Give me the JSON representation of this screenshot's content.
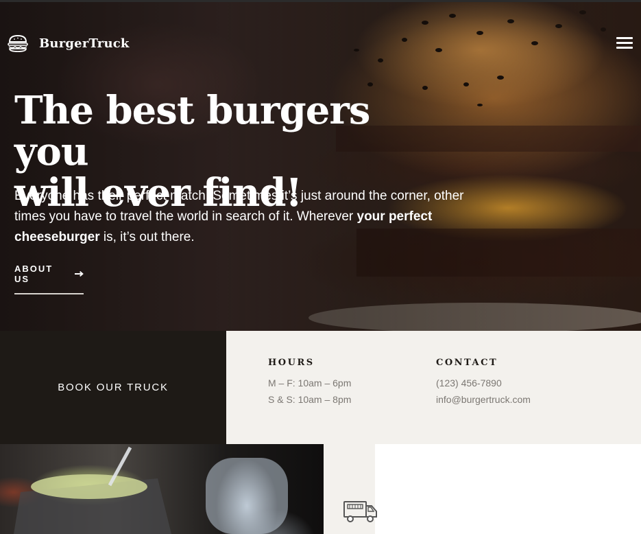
{
  "header": {
    "brand_name": "BurgerTruck",
    "logo_icon": "burger-icon",
    "menu_icon": "hamburger-menu-icon"
  },
  "hero": {
    "title_line1": "The best burgers you",
    "title_line2": "will ever find!",
    "text_part1": "Everyone has their perfect match. Sometimes it’s just around the corner, other times you have to travel the world in search of it. Wherever ",
    "text_bold1": "your perfect",
    "text_space": " ",
    "text_bold2": "cheeseburger",
    "text_part2": " is, it’s out there.",
    "cta_label": "ABOUT US",
    "cta_icon": "arrow-right-icon"
  },
  "booking": {
    "button_label": "BOOK OUR TRUCK"
  },
  "info": {
    "hours_heading": "HOURS",
    "hours_weekday": "M – F: 10am – 6pm",
    "hours_weekend": "S & S: 10am – 8pm",
    "contact_heading": "CONTACT",
    "phone": "(123) 456-7890",
    "email": "info@burgertruck.com"
  },
  "footer_strip": {
    "truck_icon": "food-truck-icon"
  },
  "colors": {
    "dark_panel": "#1e1a16",
    "light_panel": "#f3f1ed",
    "muted_text": "#7b7772",
    "white": "#ffffff"
  }
}
